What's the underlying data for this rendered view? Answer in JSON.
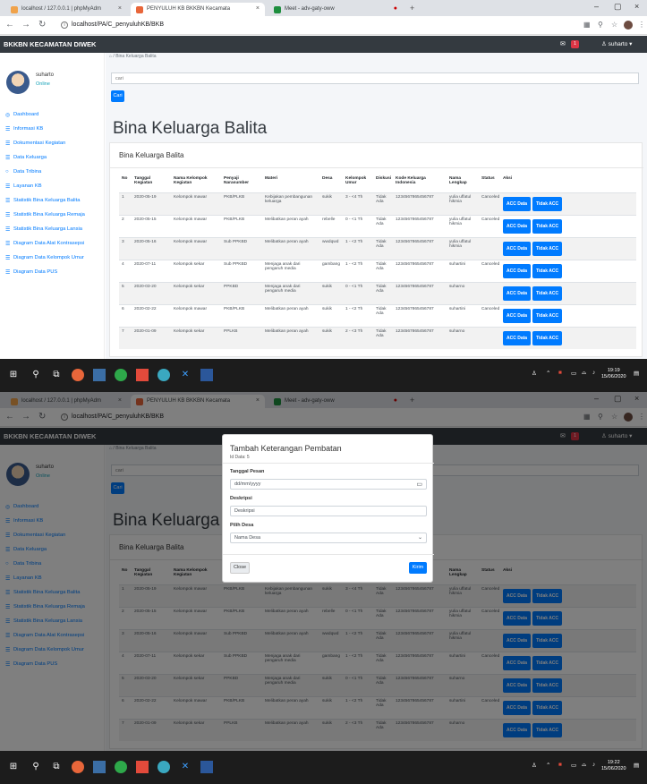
{
  "browser": {
    "tabs": [
      {
        "title": "localhost / 127.0.0.1 | phpMyAdm"
      },
      {
        "title": "PENYULUH KB BKKBN Kecamata"
      },
      {
        "title": "Meet - adv-gaty-oww"
      }
    ],
    "url": "localhost/PA/C_penyuluhKB/BKB",
    "close_glyph": "×",
    "new_tab_glyph": "+"
  },
  "app": {
    "brand": "BKKBN KECAMATAN DIWEK",
    "nav_badge": "1",
    "nav_user": "suharto",
    "sidebar_user": {
      "name": "suharto",
      "status": "Online"
    },
    "menu": [
      {
        "label": "Dashboard",
        "icon": "dashboard-icon"
      },
      {
        "label": "Informasi KB",
        "icon": "list-icon"
      },
      {
        "label": "Dokumentasi Kegiatan",
        "icon": "list-icon"
      },
      {
        "label": "Data Keluarga",
        "icon": "list-icon"
      },
      {
        "label": "Data Tribina",
        "icon": "circle-icon"
      },
      {
        "label": "Layanan KB",
        "icon": "list-icon"
      },
      {
        "label": "Statistik Bina Keluarga Balita",
        "icon": "list-icon"
      },
      {
        "label": "Statistik Bina Keluarga Remaja",
        "icon": "list-icon"
      },
      {
        "label": "Statistik Bina Keluarga Lansia",
        "icon": "list-icon"
      },
      {
        "label": "Diagram Data Alat Kontrasepsi",
        "icon": "list-icon"
      },
      {
        "label": "Diagram Data Kelompok Umur",
        "icon": "list-icon"
      },
      {
        "label": "Diagram Data PUS",
        "icon": "list-icon"
      }
    ],
    "breadcrumb": "Bina Keluarga Balita",
    "search_placeholder": "cari",
    "search_button": "Cari",
    "page_title": "Bina Keluarga Balita",
    "card_title": "Bina Keluarga Balita",
    "table": {
      "headers": [
        "No",
        "Tanggal Kegiatan",
        "Nama Kelompok Kegiatan",
        "Penyaji Narasumber",
        "Materi",
        "Desa",
        "Kelompok Umur",
        "Diskusi",
        "Kode Keluarga Indonesia",
        "Nama Lengkap",
        "Status",
        "Aksi"
      ],
      "rows": [
        [
          "1",
          "2020-05-19",
          "Kelompok mawar",
          "PKB/PLKB",
          "Kebijakan pembangunan keluarga",
          "sukik",
          "3 - <4 Th",
          "Tidak Ada",
          "1234567865456787",
          "yulia uffatul hikmia",
          "Canceled"
        ],
        [
          "2",
          "2020-05-15",
          "Kelompok mawar",
          "PKB/PLKB",
          "Melibatkan peran ayah",
          "rebelle",
          "0 - <1 Th",
          "Tidak Ada",
          "1234567865456787",
          "yulia uffatul hikmia",
          "Canceled"
        ],
        [
          "3",
          "2020-05-16",
          "Kelompok mawar",
          "Sub PPKBD",
          "Melibatkan peran ayah",
          "wwdqwd",
          "1 - <2 Th",
          "Tidak Ada",
          "1234567865456787",
          "yulia uffatul hikmia",
          ""
        ],
        [
          "4",
          "2020-07-11",
          "Kelompok sekar",
          "Sub PPKBD",
          "Menjaga anak dari pengaruh media",
          "gambang",
          "1 - <2 Th",
          "Tidak Ada",
          "1234567865456787",
          "suhartini",
          "Canceled"
        ],
        [
          "5",
          "2020-03-20",
          "Kelompok sekar",
          "PPKBD",
          "Menjaga anak dari pengaruh media",
          "sukik",
          "0 - <1 Th",
          "Tidak Ada",
          "1234567865456787",
          "suharno",
          ""
        ],
        [
          "6",
          "2020-02-22",
          "Kelompok mawar",
          "PKB/PLKB",
          "Melibatkan peran ayah",
          "sukik",
          "1 - <2 Th",
          "Tidak Ada",
          "1234567865456787",
          "suhartini",
          "Canceled"
        ],
        [
          "7",
          "2020-01-09",
          "Kelompok sekar",
          "PPLKB",
          "Melibatkan peran ayah",
          "sukik",
          "2 - <3 Th",
          "Tidak Ada",
          "1234567865456787",
          "suharno",
          ""
        ]
      ],
      "acc_label": "ACC Data",
      "reject_label": "Tidak ACC"
    }
  },
  "modal": {
    "title": "Tambah Keterangan Pembatan",
    "subtitle": "Id Data: 5",
    "date_label": "Tanggal Pesan",
    "date_placeholder": "dd/mm/yyyy",
    "desc_label": "Deskripsi",
    "desc_placeholder": "Deskripsi",
    "desa_label": "Pilih Desa",
    "desa_selected": "Nama Desa",
    "close_label": "Close",
    "submit_label": "Kirim"
  },
  "taskbar": {
    "top_time": "19:19",
    "top_date": "15/06/2020",
    "bottom_time": "19:22",
    "bottom_date": "15/06/2020"
  },
  "colors": {
    "accent": "#007bff",
    "navbar": "#343a40",
    "taskbar": "#1c1c1c",
    "danger": "#dc3545"
  }
}
